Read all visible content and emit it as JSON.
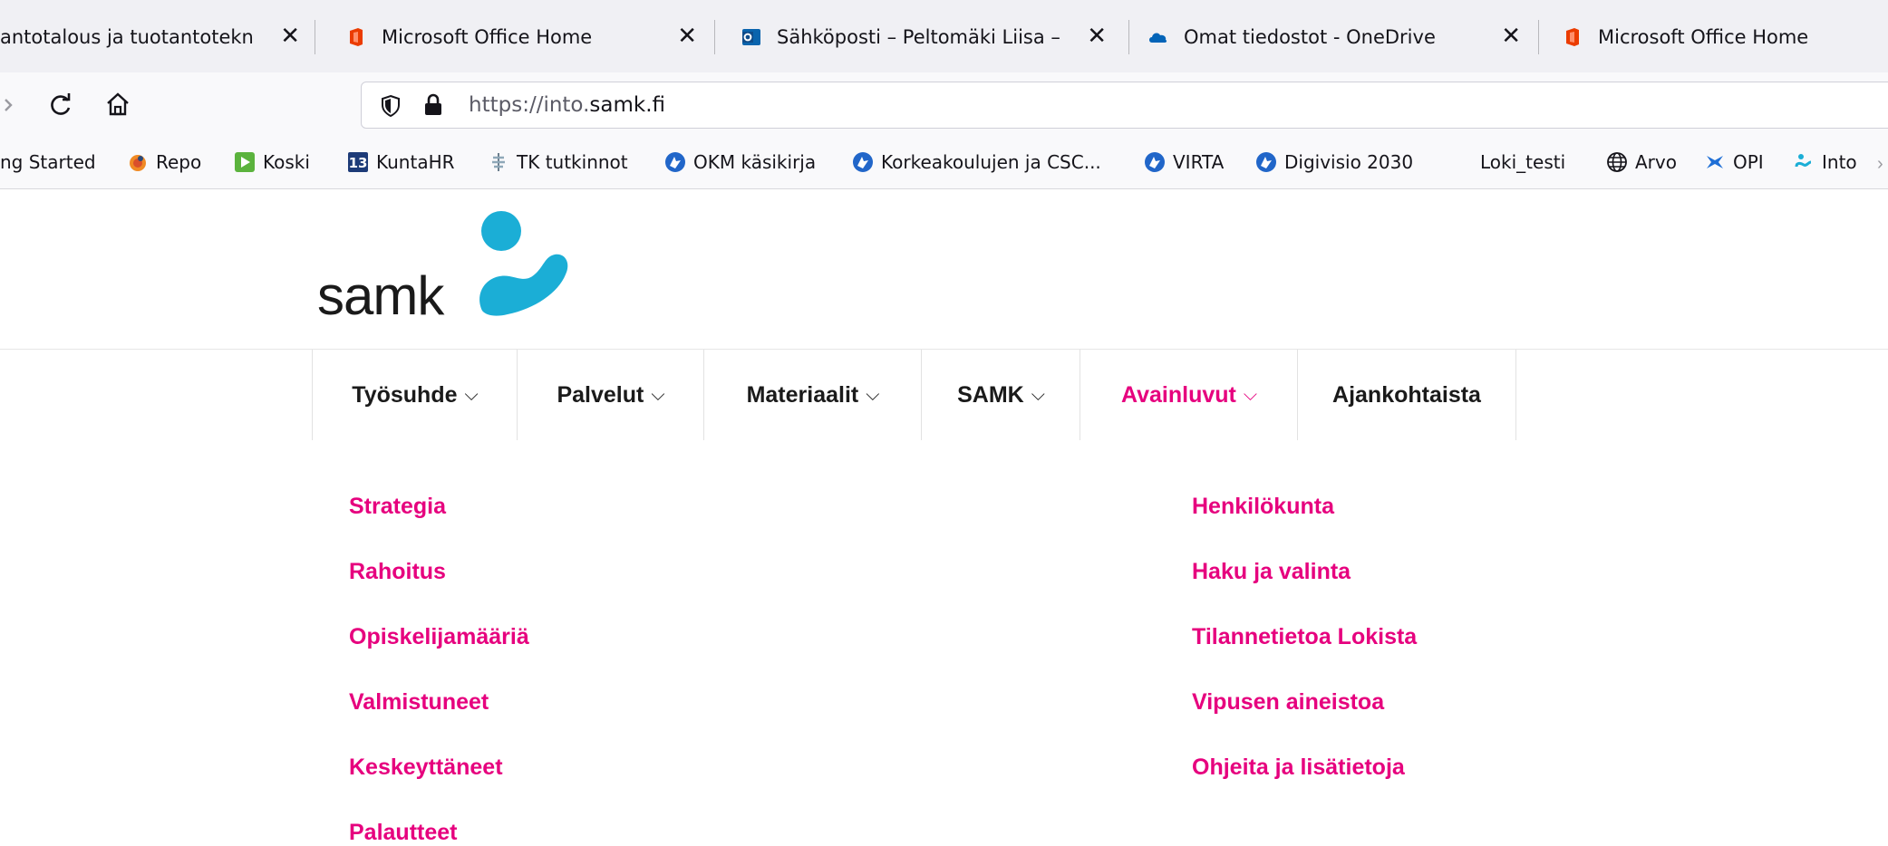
{
  "browser": {
    "tabs": [
      {
        "title": "antotalous ja tuotantotekn",
        "close": "✕"
      },
      {
        "title": "Microsoft Office Home",
        "close": "✕"
      },
      {
        "title": "Sähköposti – Peltomäki Liisa – (",
        "close": "✕"
      },
      {
        "title": "Omat tiedostot - OneDrive",
        "close": "✕"
      },
      {
        "title": "Microsoft Office Home",
        "close": ""
      }
    ],
    "url_prefix": "https://into.",
    "url_domain": "samk.fi",
    "bookmarks": [
      {
        "label": "ng Started"
      },
      {
        "label": "Repo"
      },
      {
        "label": "Koski"
      },
      {
        "label": "KuntaHR"
      },
      {
        "label": "TK tutkinnot"
      },
      {
        "label": "OKM käsikirja"
      },
      {
        "label": "Korkeakoulujen ja CSC..."
      },
      {
        "label": "VIRTA"
      },
      {
        "label": "Digivisio 2030"
      },
      {
        "label": "Loki_testi"
      },
      {
        "label": "Arvo"
      },
      {
        "label": "OPI"
      },
      {
        "label": "Into"
      }
    ]
  },
  "site": {
    "logo_text": "samk",
    "nav": [
      {
        "label": "Työsuhde",
        "chevron": "⌵"
      },
      {
        "label": "Palvelut",
        "chevron": "⌵"
      },
      {
        "label": "Materiaalit",
        "chevron": "⌵"
      },
      {
        "label": "SAMK",
        "chevron": "⌵"
      },
      {
        "label": "Avainluvut",
        "chevron": "⌵"
      },
      {
        "label": "Ajankohtaista",
        "chevron": ""
      }
    ],
    "menu_left": [
      "Strategia",
      "Rahoitus",
      "Opiskelijamääriä",
      "Valmistuneet",
      "Keskeyttäneet",
      "Palautteet"
    ],
    "menu_right": [
      "Henkilökunta",
      "Haku ja valinta",
      "Tilannetietoa Lokista",
      "Vipusen aineistoa",
      "Ohjeita ja lisätietoja"
    ]
  },
  "colors": {
    "accent": "#e6007e",
    "logo_blue": "#1baed6"
  }
}
